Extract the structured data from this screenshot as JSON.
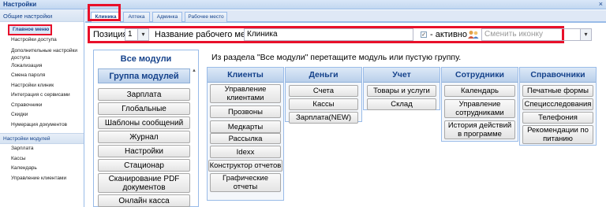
{
  "window": {
    "title": "Настройки",
    "close_glyph": "×"
  },
  "sidebar": {
    "section1": "Общие настройки",
    "items1": [
      "Главное меню",
      "Настройки доступа",
      "Дополнительные настройки доступа",
      "Локализация",
      "Смена пароля",
      "Настройки клиник",
      "Интеграция с сервисами",
      "Справочники",
      "Скидки",
      "Нумерация документов"
    ],
    "section2": "Настройки модулей",
    "items2": [
      "Зарплата",
      "Кассы",
      "Календарь",
      "Управление клиентами"
    ]
  },
  "tabs": [
    "Клиника",
    "Аптека",
    "Админка",
    "Рабочее место"
  ],
  "toolbar": {
    "position_label": "Позиция:",
    "position_value": "1",
    "name_label": "Название рабочего места:",
    "name_value": "Клиника",
    "active_label": "- активно",
    "active_checked": "✓",
    "icon_placeholder": "Сменить иконку",
    "dropdown_glyph": "▾"
  },
  "modules": {
    "title": "Все модули",
    "group_header": "Группа модулей",
    "scroll_glyph": "▲",
    "buttons": [
      "Зарплата",
      "Глобальные уведомления",
      "Шаблоны сообщений",
      "Журнал",
      "Настройки",
      "Стационар",
      "Сканирование PDF документов",
      "Онлайн касса"
    ]
  },
  "hint": "Из раздела \"Все модули\" перетащите модуль или пустую группу.",
  "columns": [
    {
      "title": "Клиенты",
      "items": [
        "Управление клиентами",
        "Прозвоны",
        "Медкарты",
        "Рассылка",
        "Idexx",
        "Конструктор отчетов",
        "Графические отчеты"
      ]
    },
    {
      "title": "Деньги",
      "items": [
        "Счета",
        "Кассы",
        "Зарплата(NEW)"
      ]
    },
    {
      "title": "Учет",
      "items": [
        "Товары и услуги",
        "Склад"
      ]
    },
    {
      "title": "Сотрудники",
      "items": [
        "Календарь",
        "Управление сотрудниками",
        "История действий в программе"
      ]
    },
    {
      "title": "Справочники",
      "items": [
        "Печатные формы",
        "Специсследования",
        "Телефония",
        "Рекомендации по питанию"
      ]
    }
  ],
  "colors": {
    "accent": "#15428b",
    "highlight": "#e8102a",
    "header": "#c2d7f0"
  }
}
